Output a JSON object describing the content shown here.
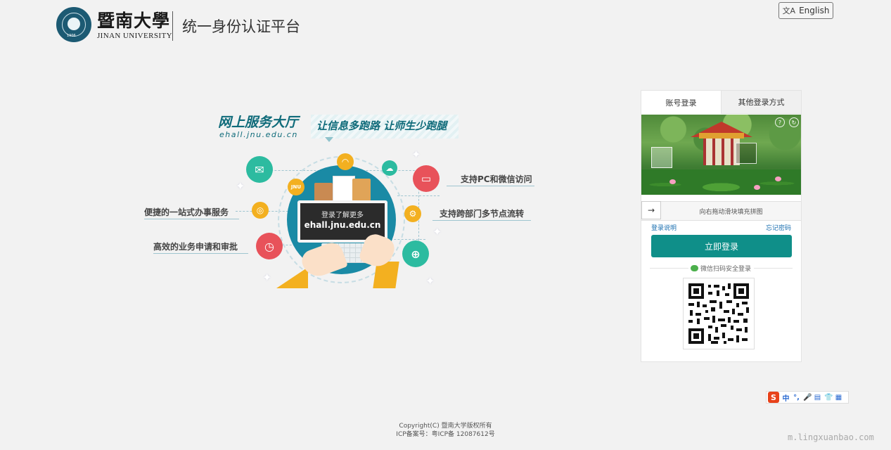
{
  "header": {
    "university_cn": "暨南大學",
    "university_en": "JINAN UNIVERSITY",
    "seal_year": "1906",
    "platform_title": "统一身份认证平台",
    "language_button": "English"
  },
  "banner": {
    "title": "网上服务大厅",
    "url": "ehall.jnu.edu.cn",
    "slogan": "让信息多跑路  让师生少跑腿"
  },
  "illustration": {
    "monitor_line1": "登录了解更多",
    "monitor_line2": "ehall.jnu.edu.cn",
    "jnu_badge": "JNU",
    "features": {
      "one_stop": "便捷的一站式办事服务",
      "apply": "高效的业务申请和审批",
      "pc_wechat": "支持PC和微信访问",
      "cross_dept": "支持跨部门多节点流转"
    }
  },
  "login": {
    "tabs": [
      "账号登录",
      "其他登录方式"
    ],
    "active_tab": 0,
    "slider_text": "向右拖动滑块填充拼图",
    "slider_handle": "→",
    "login_help": "登录说明",
    "forgot_password": "忘记密码",
    "submit": "立即登录",
    "wechat_scan": "微信扫码安全登录"
  },
  "ime_toolbar": {
    "logo": "S",
    "items": [
      "中",
      "°,",
      "🎤",
      "▤",
      "👕",
      "▦"
    ]
  },
  "footer": {
    "copyright": "Copyright(C) 暨南大学版权所有",
    "icp": "ICP备案号：粤ICP备 12087612号"
  },
  "watermark": "m.lingxuanbao.com",
  "colors": {
    "primary": "#0f8f89",
    "banner": "#0f6b7a",
    "globe": "#1a8aa5",
    "link": "#1a6fb0",
    "background": "#f2f2f2"
  }
}
